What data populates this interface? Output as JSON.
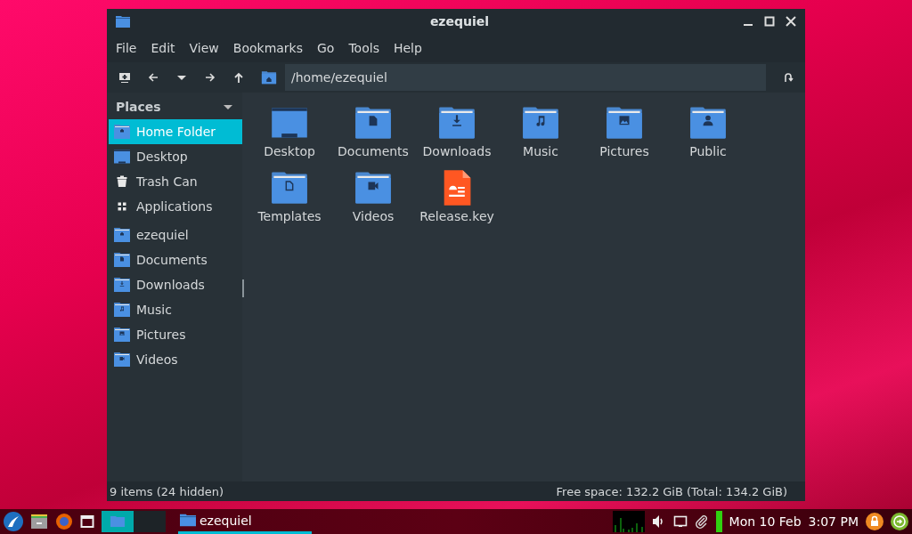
{
  "window": {
    "title": "ezequiel"
  },
  "menu": [
    "File",
    "Edit",
    "View",
    "Bookmarks",
    "Go",
    "Tools",
    "Help"
  ],
  "location": {
    "value": "/home/ezequiel"
  },
  "sidebar": {
    "header": "Places",
    "expanded": true,
    "places": [
      {
        "label": "Home Folder",
        "kind": "home",
        "selected": true
      },
      {
        "label": "Desktop",
        "kind": "desktop",
        "selected": false
      },
      {
        "label": "Trash Can",
        "kind": "trash",
        "selected": false
      },
      {
        "label": "Applications",
        "kind": "apps",
        "selected": false
      }
    ],
    "bookmarks": [
      {
        "label": "ezequiel",
        "kind": "home",
        "selected": false
      },
      {
        "label": "Documents",
        "kind": "documents",
        "selected": false
      },
      {
        "label": "Downloads",
        "kind": "downloads",
        "selected": false
      },
      {
        "label": "Music",
        "kind": "music",
        "selected": false
      },
      {
        "label": "Pictures",
        "kind": "pictures",
        "selected": false
      },
      {
        "label": "Videos",
        "kind": "videos",
        "selected": false
      }
    ]
  },
  "files": [
    {
      "name": "Desktop",
      "kind": "desktop"
    },
    {
      "name": "Documents",
      "kind": "documents"
    },
    {
      "name": "Downloads",
      "kind": "downloads"
    },
    {
      "name": "Music",
      "kind": "music"
    },
    {
      "name": "Pictures",
      "kind": "pictures"
    },
    {
      "name": "Public",
      "kind": "public"
    },
    {
      "name": "Templates",
      "kind": "templates"
    },
    {
      "name": "Videos",
      "kind": "videos"
    },
    {
      "name": "Release.key",
      "kind": "document-file"
    }
  ],
  "status_bar": {
    "items": "9 items (24 hidden)",
    "free_space": "Free space: 132.2 GiB (Total: 134.2 GiB)"
  },
  "taskbar": {
    "task": {
      "label": "ezequiel",
      "selected": true
    },
    "date": "Mon 10 Feb",
    "time": "3:07 PM"
  }
}
